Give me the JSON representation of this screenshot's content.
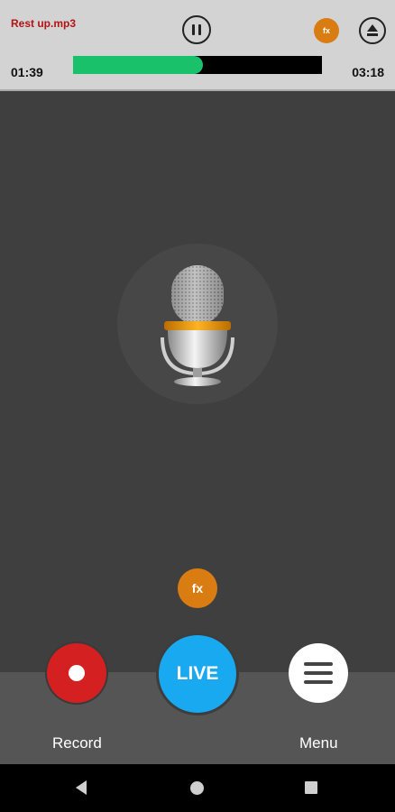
{
  "player": {
    "track_title": "Rest up.mp3",
    "elapsed": "01:39",
    "duration": "03:18",
    "progress_fraction": 0.52,
    "progress_color": "#19c16b",
    "fx_label": "fx"
  },
  "main": {
    "fx_label": "fx"
  },
  "controls": {
    "record_label": "Record",
    "live_label": "LIVE",
    "menu_label": "Menu"
  },
  "colors": {
    "record": "#d42021",
    "live": "#19a9f0",
    "fx": "#d97d12"
  }
}
